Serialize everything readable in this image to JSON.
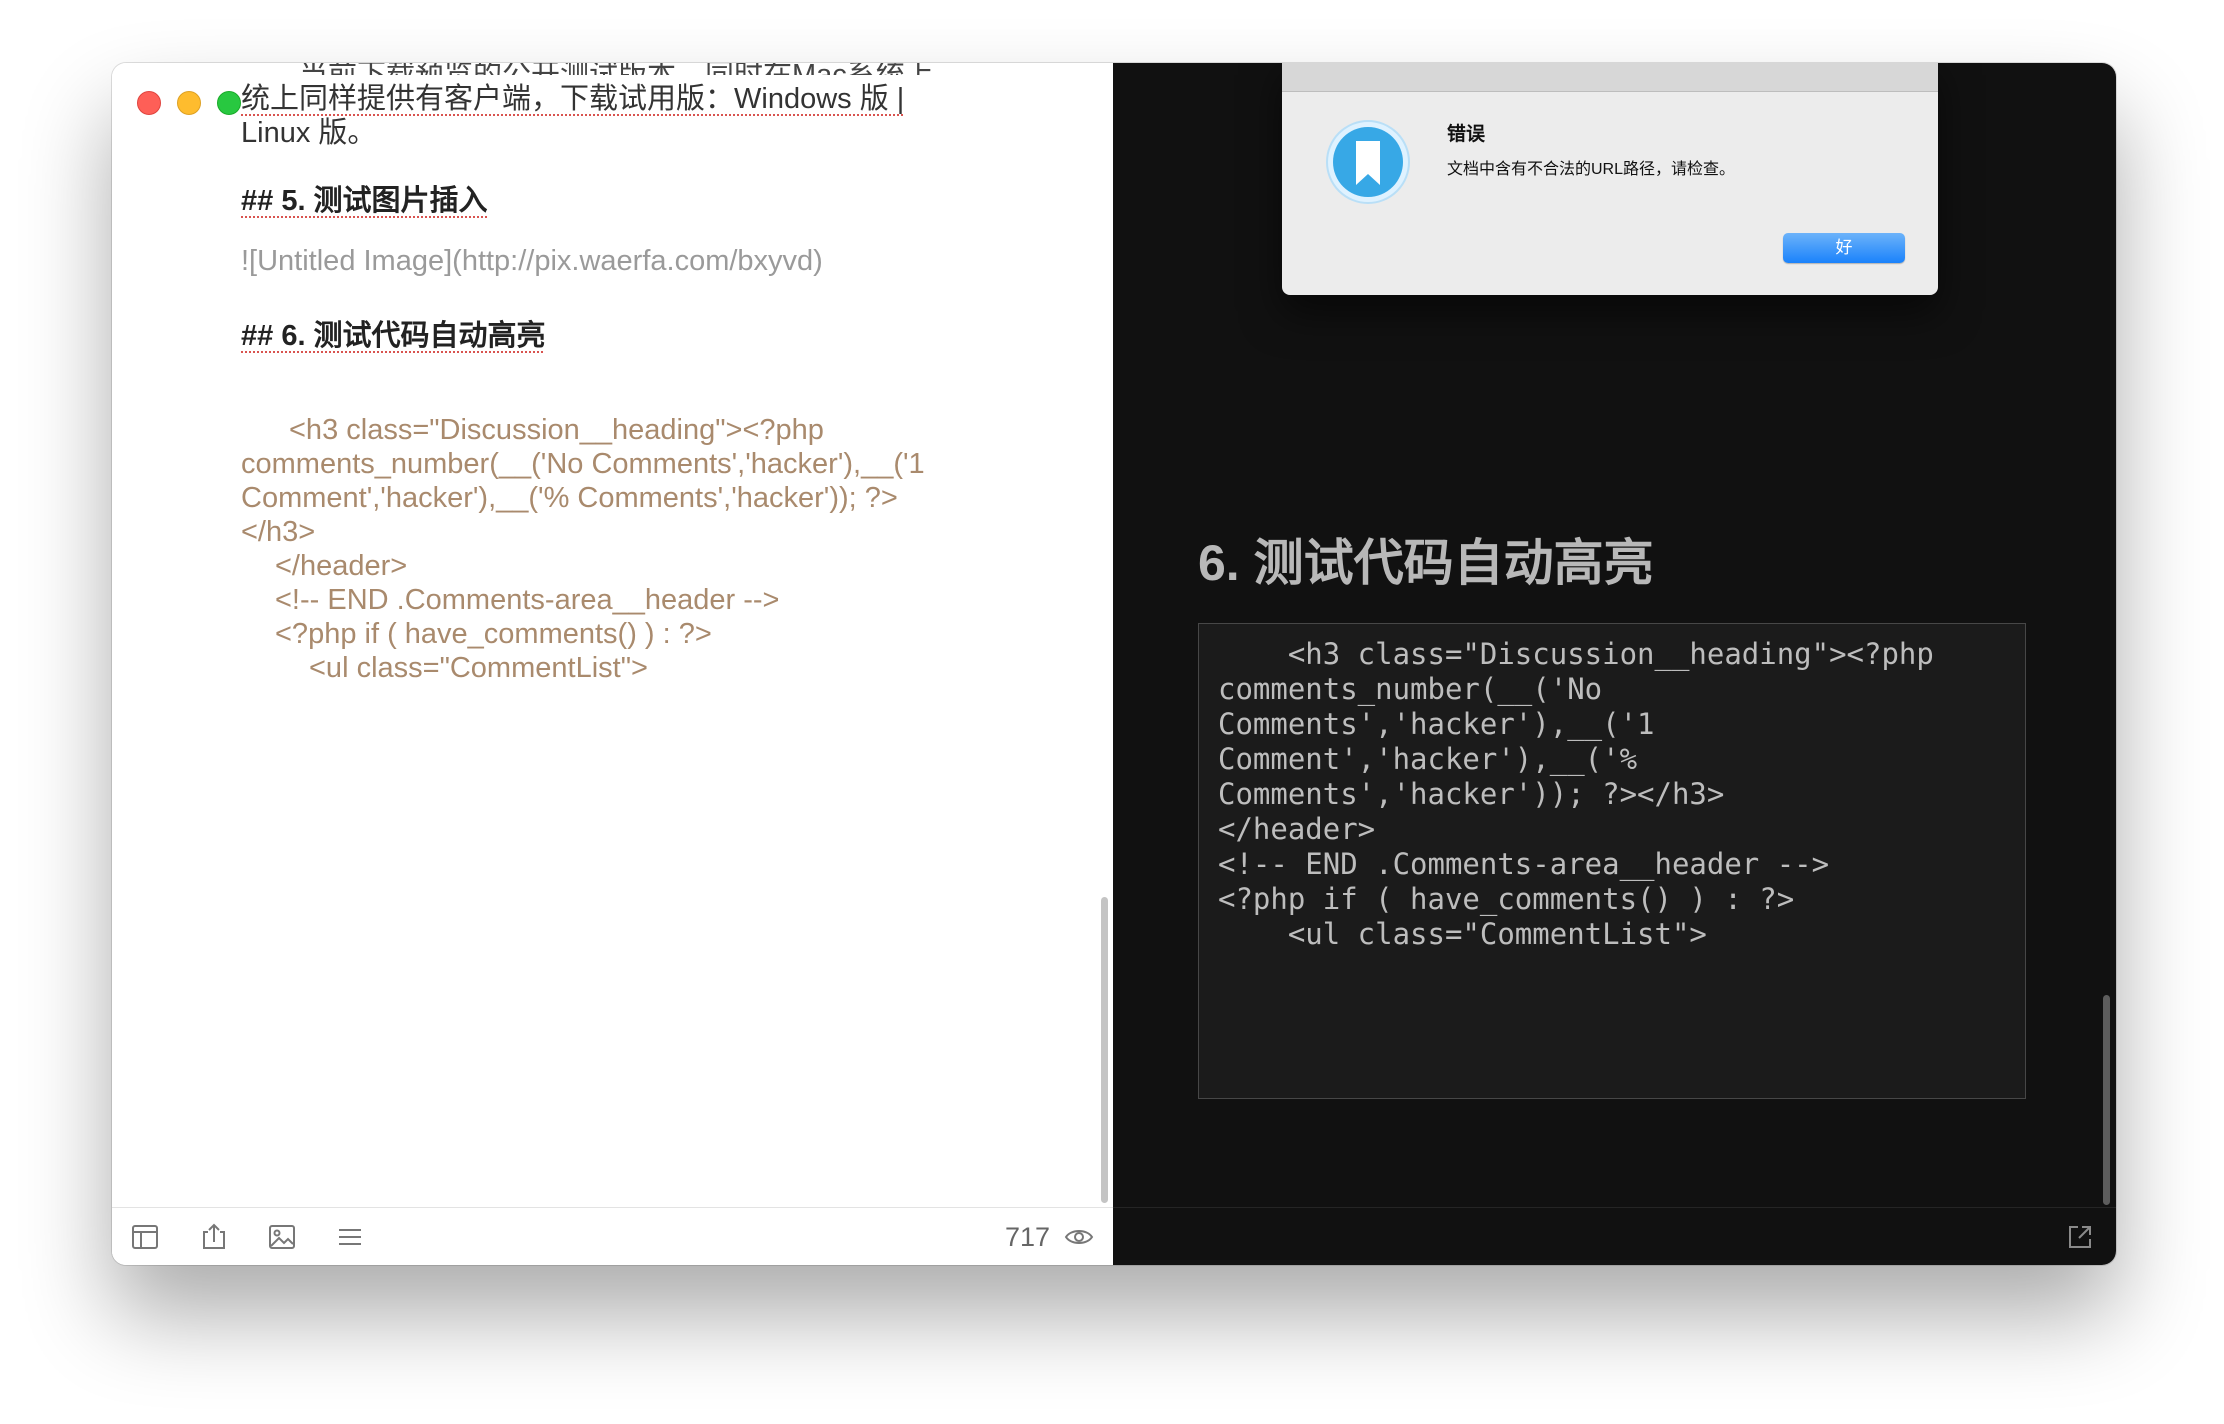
{
  "editor": {
    "cutoff_line": "……当前下载预览的公开测试版本，同时在Mac系统上",
    "lines": {
      "l1": "统上同样提供有客户端，下载试用版：Windows 版 |",
      "l2": "Linux 版。",
      "h5": "## 5. 测试图片插入",
      "img": "![Untitled Image](http://pix.waerfa.com/bxyvd)",
      "h6": "## 6. 测试代码自动高亮",
      "c1": "<h3 class=\"Discussion__heading\"><?php",
      "c2": "comments_number(__('No Comments','hacker'),__('1",
      "c3": "Comment','hacker'),__('% Comments','hacker')); ?>",
      "c4": "</h3>",
      "c5": "</header>",
      "c6": "<!-- END .Comments-area__header -->",
      "c7": "<?php if ( have_comments() ) : ?>",
      "c8": "<ul class=\"CommentList\">"
    },
    "footer": {
      "word_count": "717",
      "icons": [
        "layout-icon",
        "export-icon",
        "image-icon",
        "menu-icon",
        "eye-icon"
      ]
    }
  },
  "preview": {
    "heading": "6. 测试代码自动高亮",
    "code_lines": [
      "    <h3 class=\"Discussion__heading\"><?php",
      "comments_number(__('No",
      "Comments','hacker'),__('1",
      "Comment','hacker'),__('%",
      "Comments','hacker')); ?></h3>",
      "</header>",
      "<!-- END .Comments-area__header -->",
      "<?php if ( have_comments() ) : ?>",
      "    <ul class=\"CommentList\">"
    ],
    "footer_icon": "open-external-icon"
  },
  "dialog": {
    "title": "错误",
    "message": "文档中含有不合法的URL路径，请检查。",
    "ok_label": "好",
    "icon": "bookmark-app-icon"
  },
  "colors": {
    "editor_bg": "#ffffff",
    "preview_bg": "#111111",
    "code_text": "#a98a6d",
    "accent_button": "#1a82fb",
    "close": "#fe5f57",
    "minimize": "#febc2e",
    "maximize": "#28c840"
  }
}
